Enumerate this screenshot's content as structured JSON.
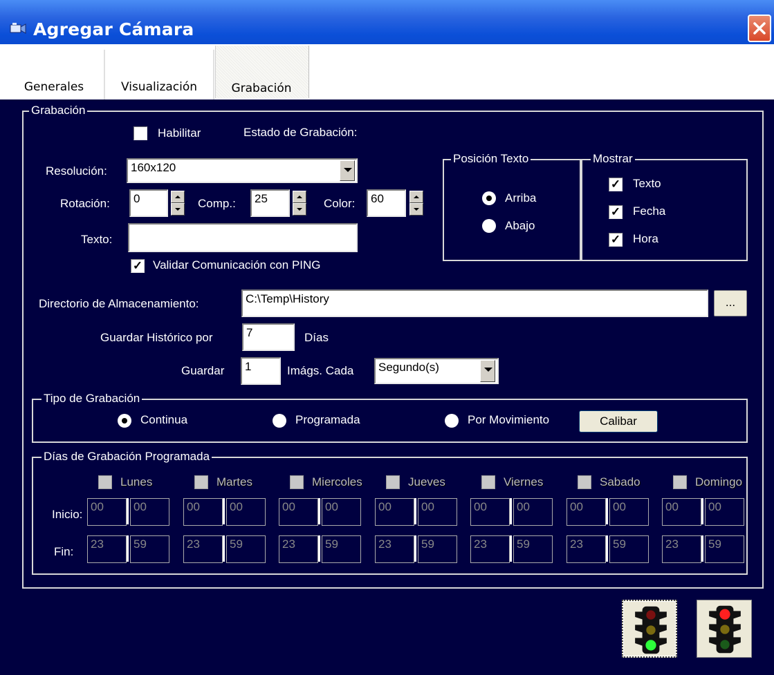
{
  "window": {
    "title": "Agregar Cámara"
  },
  "tabs": [
    {
      "label": "Generales"
    },
    {
      "label": "Visualización"
    },
    {
      "label": "Grabación"
    }
  ],
  "grabacion": {
    "legend": "Grabación",
    "habilitar": {
      "label": "Habilitar",
      "checked": false
    },
    "estado_label": "Estado de Grabación:",
    "resolucion": {
      "label": "Resolución:",
      "value": "160x120"
    },
    "rotacion": {
      "label": "Rotación:",
      "value": "0"
    },
    "comp": {
      "label": "Comp.:",
      "value": "25"
    },
    "color": {
      "label": "Color:",
      "value": "60"
    },
    "texto": {
      "label": "Texto:",
      "value": ""
    },
    "validar_ping": {
      "label": "Validar Comunicación con PING",
      "checked": true
    },
    "posicion_texto": {
      "legend": "Posición Texto",
      "options": [
        "Arriba",
        "Abajo"
      ],
      "selected": "Arriba"
    },
    "mostrar": {
      "legend": "Mostrar",
      "items": [
        {
          "label": "Texto",
          "checked": true
        },
        {
          "label": "Fecha",
          "checked": true
        },
        {
          "label": "Hora",
          "checked": true
        }
      ]
    },
    "directorio": {
      "label": "Directorio de Almacenamiento:",
      "value": "C:\\Temp\\History",
      "browse_label": "..."
    },
    "guardar_historico": {
      "label": "Guardar Histórico por",
      "value": "7",
      "unit": "Días"
    },
    "guardar": {
      "label": "Guardar",
      "value": "1",
      "mid_label": "Imágs. Cada",
      "unit_value": "Segundo(s)"
    },
    "tipo": {
      "legend": "Tipo de Grabación",
      "options": [
        "Continua",
        "Programada",
        "Por Movimiento"
      ],
      "selected": "Continua",
      "calibrar_label": "Calibar"
    },
    "programada": {
      "legend": "Días de Grabación Programada",
      "inicio_label": "Inicio:",
      "fin_label": "Fin:",
      "days": [
        {
          "name": "Lunes",
          "inicio_h": "00",
          "inicio_m": "00",
          "fin_h": "23",
          "fin_m": "59"
        },
        {
          "name": "Martes",
          "inicio_h": "00",
          "inicio_m": "00",
          "fin_h": "23",
          "fin_m": "59"
        },
        {
          "name": "Miercoles",
          "inicio_h": "00",
          "inicio_m": "00",
          "fin_h": "23",
          "fin_m": "59"
        },
        {
          "name": "Jueves",
          "inicio_h": "00",
          "inicio_m": "00",
          "fin_h": "23",
          "fin_m": "59"
        },
        {
          "name": "Viernes",
          "inicio_h": "00",
          "inicio_m": "00",
          "fin_h": "23",
          "fin_m": "59"
        },
        {
          "name": "Sabado",
          "inicio_h": "00",
          "inicio_m": "00",
          "fin_h": "23",
          "fin_m": "59"
        },
        {
          "name": "Domingo",
          "inicio_h": "00",
          "inicio_m": "00",
          "fin_h": "23",
          "fin_m": "59"
        }
      ]
    }
  },
  "actions": {
    "accept_icon": "traffic-light-green-icon",
    "cancel_icon": "traffic-light-red-icon"
  },
  "colors": {
    "background": "#000040",
    "titlebar": "#0b4fd8",
    "close": "#d9492a"
  }
}
